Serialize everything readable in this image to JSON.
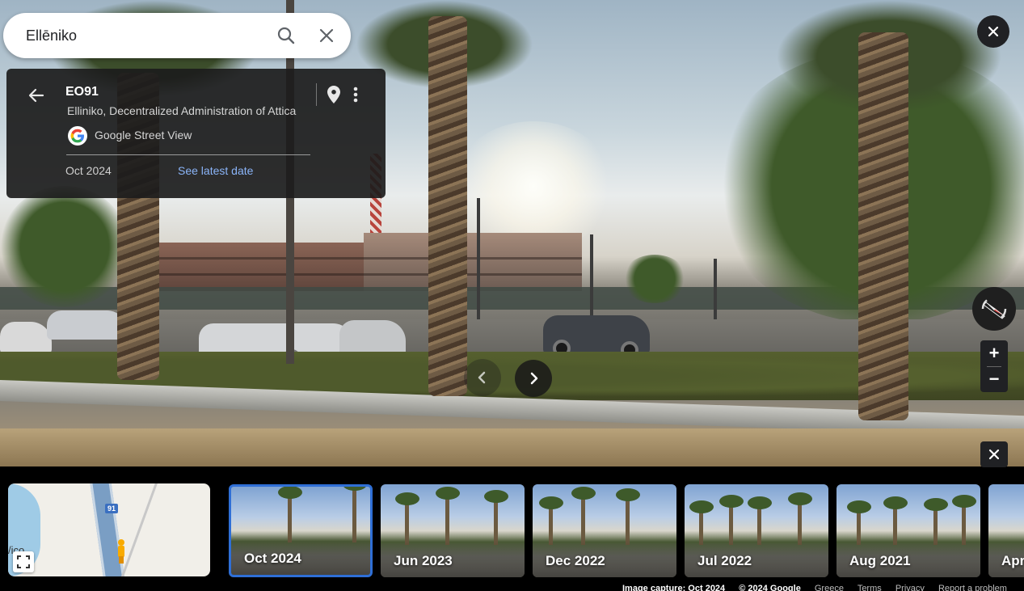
{
  "search": {
    "query": "Ellēniko",
    "search_icon": "search-icon",
    "clear_icon": "close-icon"
  },
  "info_card": {
    "title": "EO91",
    "subtitle": "Elliniko, Decentralized Administration of Attica",
    "provider": "Google Street View",
    "date": "Oct 2024",
    "latest_link": "See latest date"
  },
  "controls": {
    "zoom_in": "+",
    "zoom_out": "−"
  },
  "minimap": {
    "road_shield": "91",
    "place_fragment": "/ico"
  },
  "timeline": [
    {
      "label": "Oct 2024"
    },
    {
      "label": "Jun 2023"
    },
    {
      "label": "Dec 2022"
    },
    {
      "label": "Jul 2022"
    },
    {
      "label": "Aug 2021"
    },
    {
      "label": "Apr"
    }
  ],
  "footer": {
    "capture": "Image capture: Oct 2024",
    "copyright": "© 2024 Google",
    "region": "Greece",
    "terms": "Terms",
    "privacy": "Privacy",
    "report": "Report a problem"
  },
  "colors": {
    "link": "#8ab4f8",
    "selected_border": "#2f6fd6",
    "card_bg": "#1c1c1c"
  }
}
